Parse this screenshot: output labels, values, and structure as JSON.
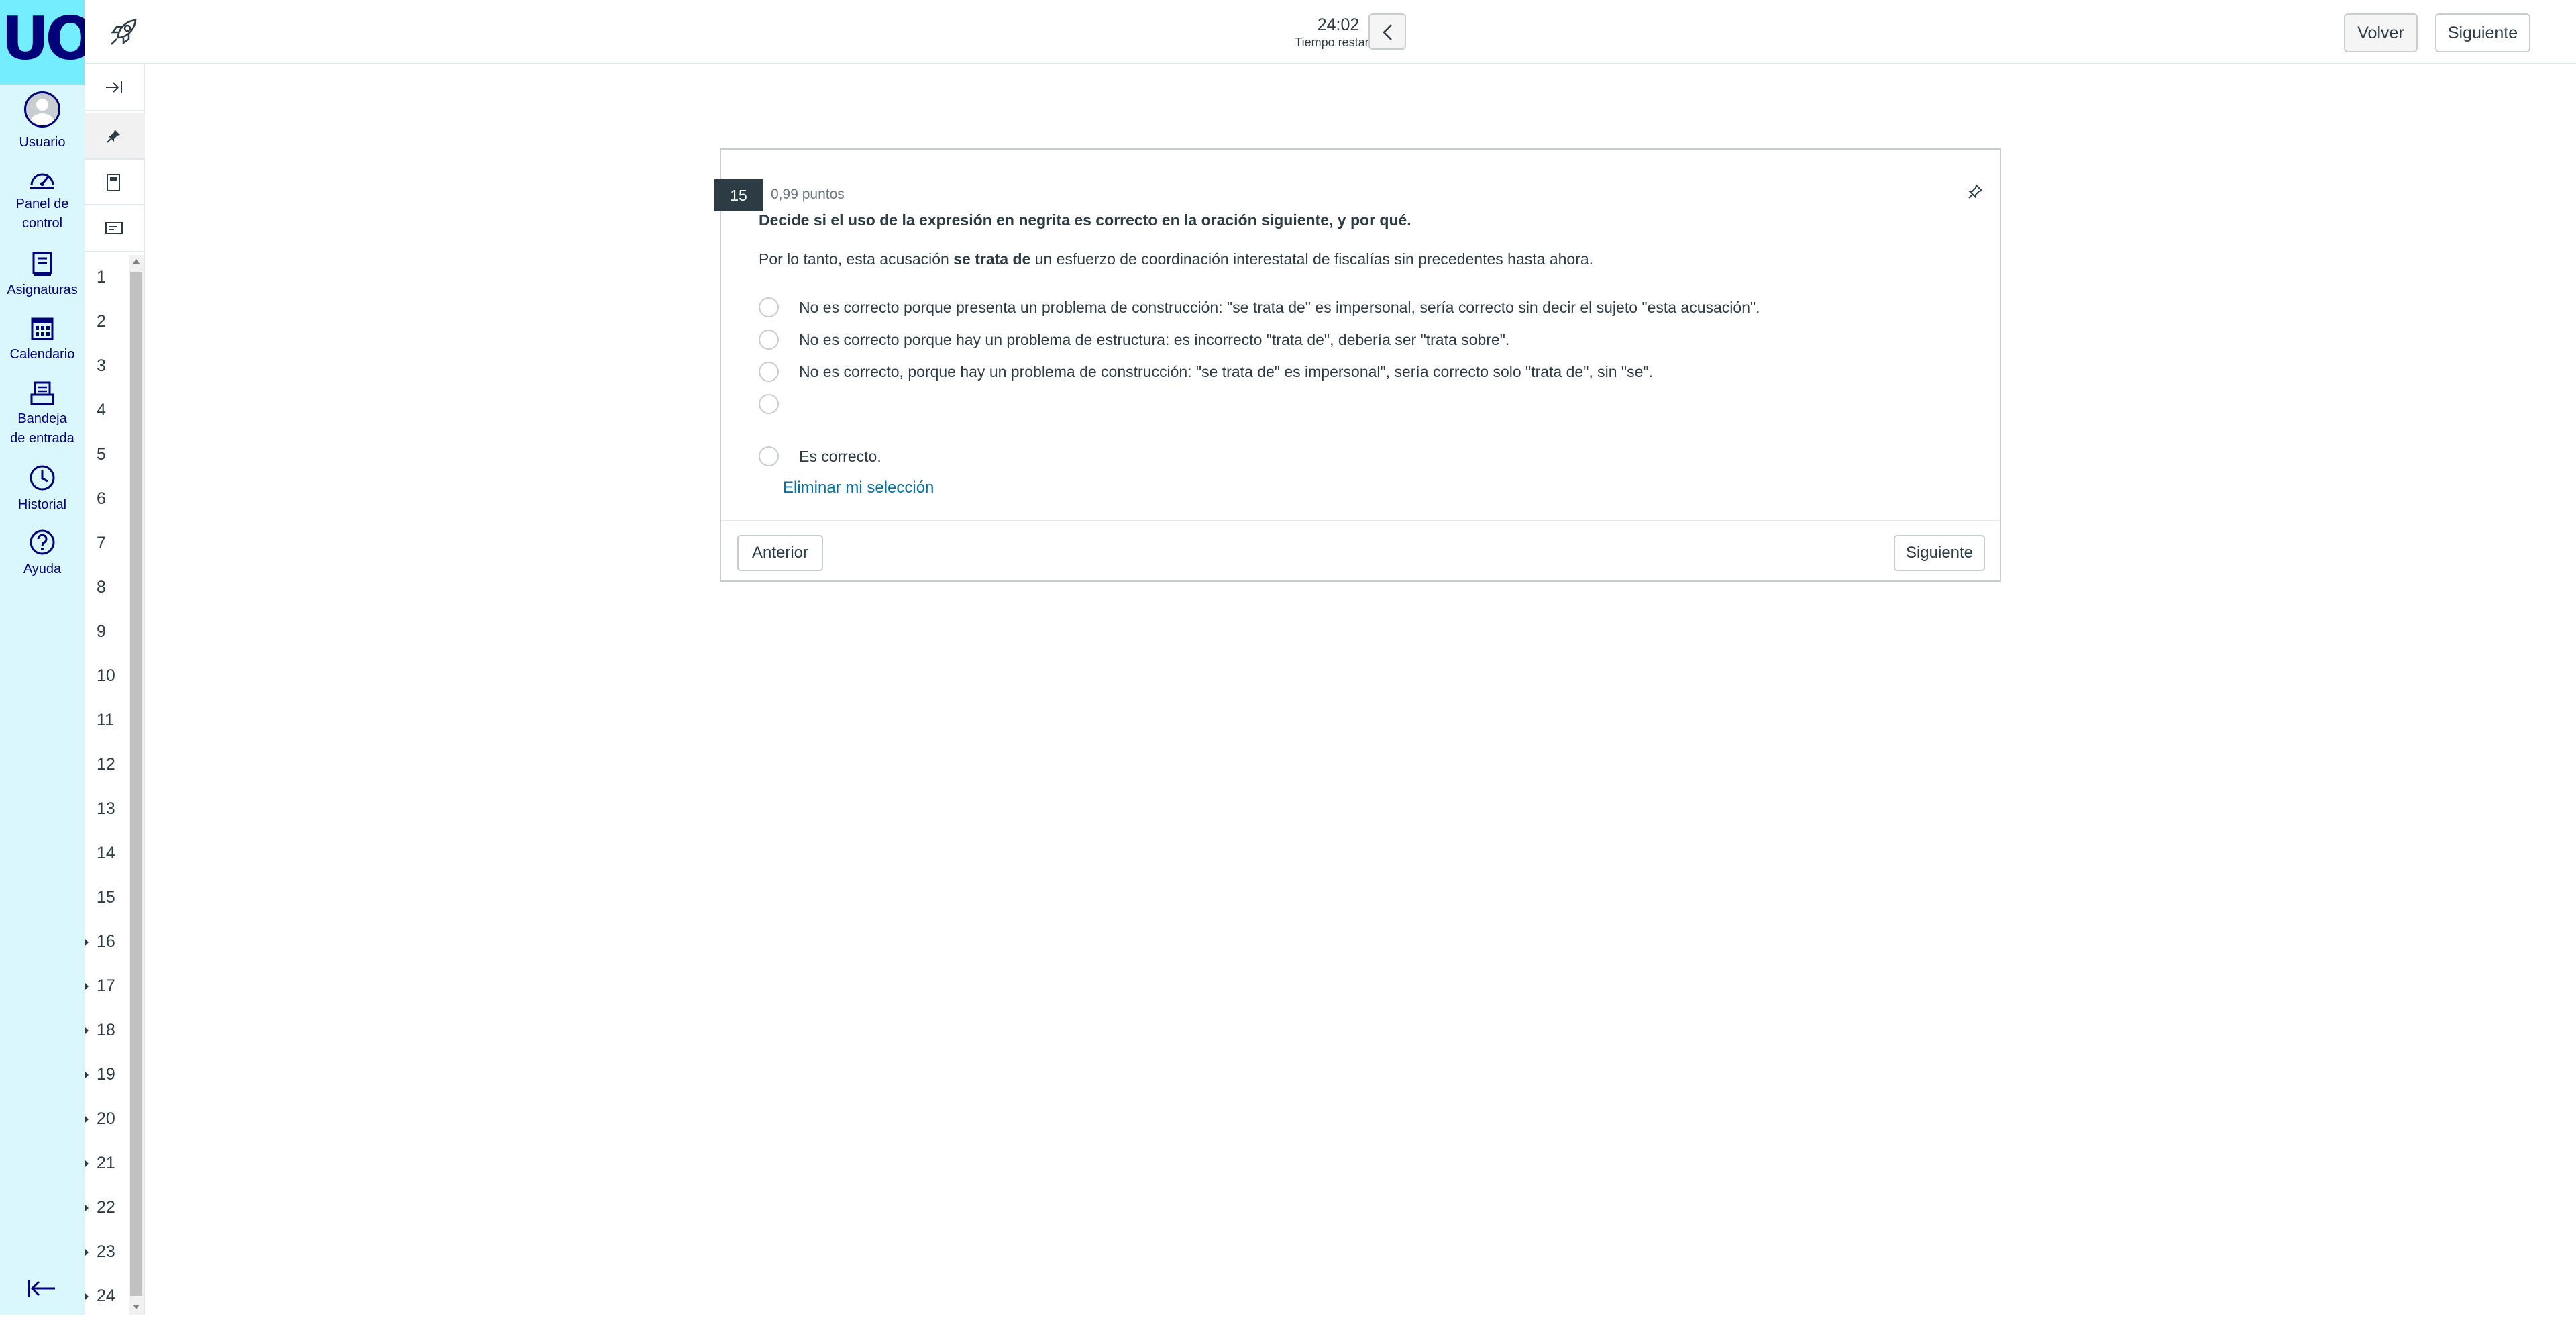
{
  "logo": {
    "text": "UOC"
  },
  "global_nav": {
    "items": [
      {
        "label": "Usuario",
        "icon": "avatar"
      },
      {
        "label": "Panel de control",
        "icon": "dashboard-icon"
      },
      {
        "label": "Asignaturas",
        "icon": "courses-icon"
      },
      {
        "label": "Calendario",
        "icon": "calendar-icon"
      },
      {
        "label": "Bandeja de entrada",
        "icon": "inbox-icon"
      },
      {
        "label": "Historial",
        "icon": "clock-icon"
      },
      {
        "label": "Ayuda",
        "icon": "help-icon"
      }
    ]
  },
  "header": {
    "timer_value": "24:02",
    "timer_label": "Tiempo restante",
    "volver_label": "Volver",
    "siguiente_label": "Siguiente"
  },
  "question_nav": {
    "numbers": [
      "1",
      "2",
      "3",
      "4",
      "5",
      "6",
      "7",
      "8",
      "9",
      "10",
      "11",
      "12",
      "13",
      "14",
      "15",
      "16",
      "17",
      "18",
      "19",
      "20",
      "21",
      "22",
      "23",
      "24"
    ]
  },
  "question": {
    "number": "15",
    "points": "0,99 puntos",
    "title": "Decide si el uso de la expresión en negrita es correcto en la oración siguiente, y por qué.",
    "sentence_before": "Por lo tanto, esta acusación ",
    "sentence_bold": "se trata de",
    "sentence_after": " un esfuerzo de coordinación interestatal de fiscalías sin precedentes hasta ahora.",
    "answers": [
      "No es correcto porque presenta un problema de construcción: \"se trata de\" es impersonal, sería correcto sin decir el sujeto \"esta acusación\".",
      "No es correcto porque hay un problema de estructura: es incorrecto \"trata de\", debería ser \"trata sobre\".",
      "No es correcto, porque hay un problema de construcción: \"se trata de\" es impersonal\", sería correcto solo \"trata de\", sin \"se\".",
      "",
      "Es correcto."
    ],
    "clear_label": "Eliminar mi selección",
    "prev_label": "Anterior",
    "next_label": "Siguiente"
  },
  "colors": {
    "nav_background": "#d9f7fd",
    "logo_background": "#73edff",
    "brand_dark": "#000078",
    "link": "#0770a3",
    "question_number_bg": "#2d3b45"
  }
}
